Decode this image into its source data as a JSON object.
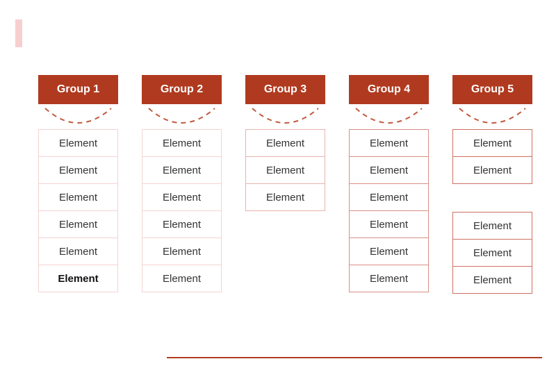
{
  "accent_color": "#f7cfcf",
  "header_bg": "#b03a1f",
  "groups": [
    {
      "title": "Group 1",
      "border_style": "faint",
      "sections": [
        {
          "items": [
            {
              "label": "Element",
              "bold": false
            },
            {
              "label": "Element",
              "bold": false
            },
            {
              "label": "Element",
              "bold": false
            },
            {
              "label": "Element",
              "bold": false
            },
            {
              "label": "Element",
              "bold": false
            },
            {
              "label": "Element",
              "bold": true
            }
          ]
        }
      ]
    },
    {
      "title": "Group 2",
      "border_style": "faint",
      "sections": [
        {
          "items": [
            {
              "label": "Element",
              "bold": false
            },
            {
              "label": "Element",
              "bold": false
            },
            {
              "label": "Element",
              "bold": false
            },
            {
              "label": "Element",
              "bold": false
            },
            {
              "label": "Element",
              "bold": false
            },
            {
              "label": "Element",
              "bold": false
            }
          ]
        }
      ]
    },
    {
      "title": "Group 3",
      "border_style": "light",
      "sections": [
        {
          "items": [
            {
              "label": "Element",
              "bold": false
            },
            {
              "label": "Element",
              "bold": false
            },
            {
              "label": "Element",
              "bold": false
            }
          ]
        }
      ]
    },
    {
      "title": "Group 4",
      "border_style": "medium",
      "sections": [
        {
          "items": [
            {
              "label": "Element",
              "bold": false
            },
            {
              "label": "Element",
              "bold": false
            },
            {
              "label": "Element",
              "bold": false
            },
            {
              "label": "Element",
              "bold": false
            },
            {
              "label": "Element",
              "bold": false
            },
            {
              "label": "Element",
              "bold": false
            }
          ]
        }
      ]
    },
    {
      "title": "Group 5",
      "border_style": "strong",
      "sections": [
        {
          "items": [
            {
              "label": "Element",
              "bold": false
            },
            {
              "label": "Element",
              "bold": false
            }
          ]
        },
        {
          "items": [
            {
              "label": "Element",
              "bold": false
            },
            {
              "label": "Element",
              "bold": false
            },
            {
              "label": "Element",
              "bold": false
            }
          ]
        }
      ]
    }
  ]
}
